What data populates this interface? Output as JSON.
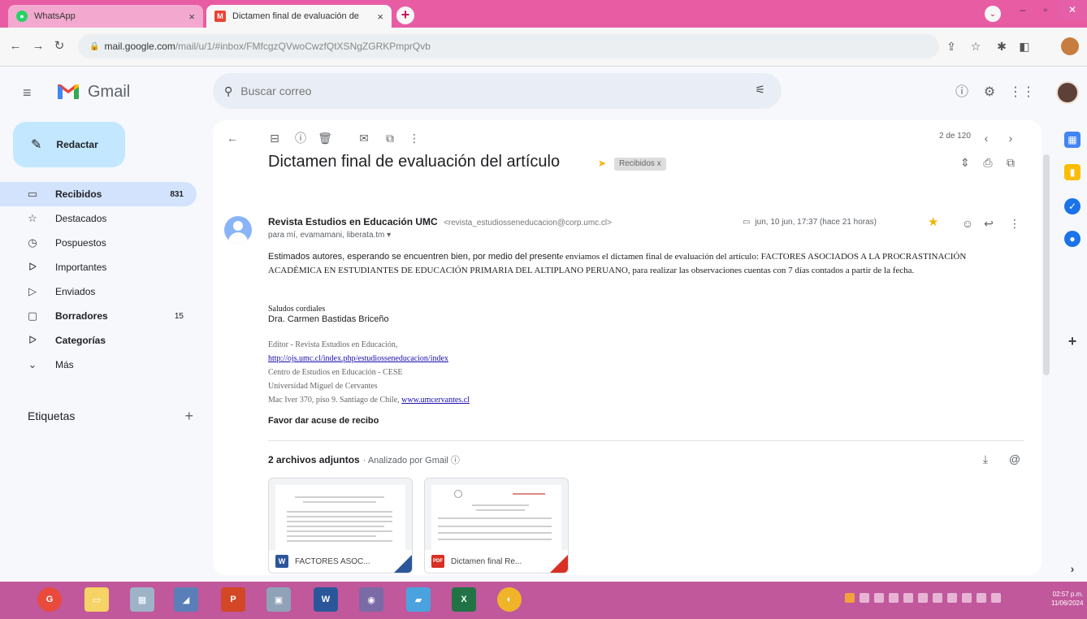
{
  "browser": {
    "tabs": [
      {
        "title": "WhatsApp",
        "active": false,
        "close": "×"
      },
      {
        "title": "Dictamen final de evaluación de",
        "active": true,
        "close": "×"
      }
    ],
    "new_tab": "+",
    "address": {
      "host": "mail.google.com",
      "path": "/mail/u/1/#inbox/FMfcgzQVwoCwzfQtXSNgZGRKPmprQvb"
    }
  },
  "gmail": {
    "product": "Gmail",
    "search_placeholder": "Buscar correo",
    "compose": "Redactar",
    "nav": [
      {
        "label": "Recibidos",
        "icon": "inbox-icon",
        "glyph": "▭",
        "count": "831",
        "active": true,
        "bold": true
      },
      {
        "label": "Destacados",
        "icon": "star-outline-icon",
        "glyph": "☆",
        "count": "",
        "active": false,
        "bold": false
      },
      {
        "label": "Pospuestos",
        "icon": "clock-icon",
        "glyph": "◷",
        "count": "",
        "active": false,
        "bold": false
      },
      {
        "label": "Importantes",
        "icon": "important-icon",
        "glyph": "ᐅ",
        "count": "",
        "active": false,
        "bold": false
      },
      {
        "label": "Enviados",
        "icon": "send-icon",
        "glyph": "▷",
        "count": "",
        "active": false,
        "bold": false
      },
      {
        "label": "Borradores",
        "icon": "draft-icon",
        "glyph": "▢",
        "count": "15",
        "active": false,
        "bold": true
      },
      {
        "label": "Categorías",
        "icon": "label-icon",
        "glyph": "ᐅ",
        "count": "",
        "active": false,
        "bold": true
      },
      {
        "label": "Más",
        "icon": "chevron-down-icon",
        "glyph": "⌄",
        "count": "",
        "active": false,
        "bold": false
      }
    ],
    "labels_header": "Etiquetas"
  },
  "message": {
    "pager": "2 de 120",
    "subject": "Dictamen final de evaluación del artículo",
    "label_chip": "Recibidos x",
    "sender_name": "Revista Estudios en Educación UMC",
    "sender_email": "<revista_estudiosseneducacion@corp.umc.cl>",
    "to": "para mí, evamamani, liberata.tm ▾",
    "date": "jun, 10 jun, 17:37 (hace 21 horas)",
    "body": "Estimados autores, esperando se encuentren bien, por medio del presente enviamos el dictamen final de evaluación del artículo: FACTORES ASOCIADOS A LA PROCRASTINACIÓN ACADÉMICA EN ESTUDIANTES DE EDUCACIÓN PRIMARIA DEL ALTIPLANO PERUANO, para realizar las observaciones cuentas con 7 días contados a partir de la fecha.",
    "body_intro_end": 70,
    "greeting": "Saludos cordiales",
    "signer": "Dra. Carmen Bastidas Briceño",
    "sig_lines": [
      "Editor - Revista Estudios en Educación,",
      "http://ojs.umc.cl/index.php/estudiosseneducacion/index",
      "Centro de Estudios en Educación - CESE",
      "Universidad Miguel de Cervantes",
      "Mac Iver 370, piso 9. Santiago de Chile, "
    ],
    "sig_link_site": "www.umcervantes.cl",
    "ack": "Favor dar acuse de recibo",
    "attachments_title": "2 archivos adjuntos",
    "attachments_scanned": "· Analizado por Gmail ⓘ",
    "attachments": [
      {
        "name": "FACTORES ASOC...",
        "type_letter": "W",
        "type_color": "#2b579a"
      },
      {
        "name": "Dictamen final Re...",
        "type_letter": "PDF",
        "type_color": "#d93025"
      }
    ]
  },
  "taskbar": {
    "clock_time": "02:57 p.m.",
    "clock_date": "11/06/2024"
  }
}
